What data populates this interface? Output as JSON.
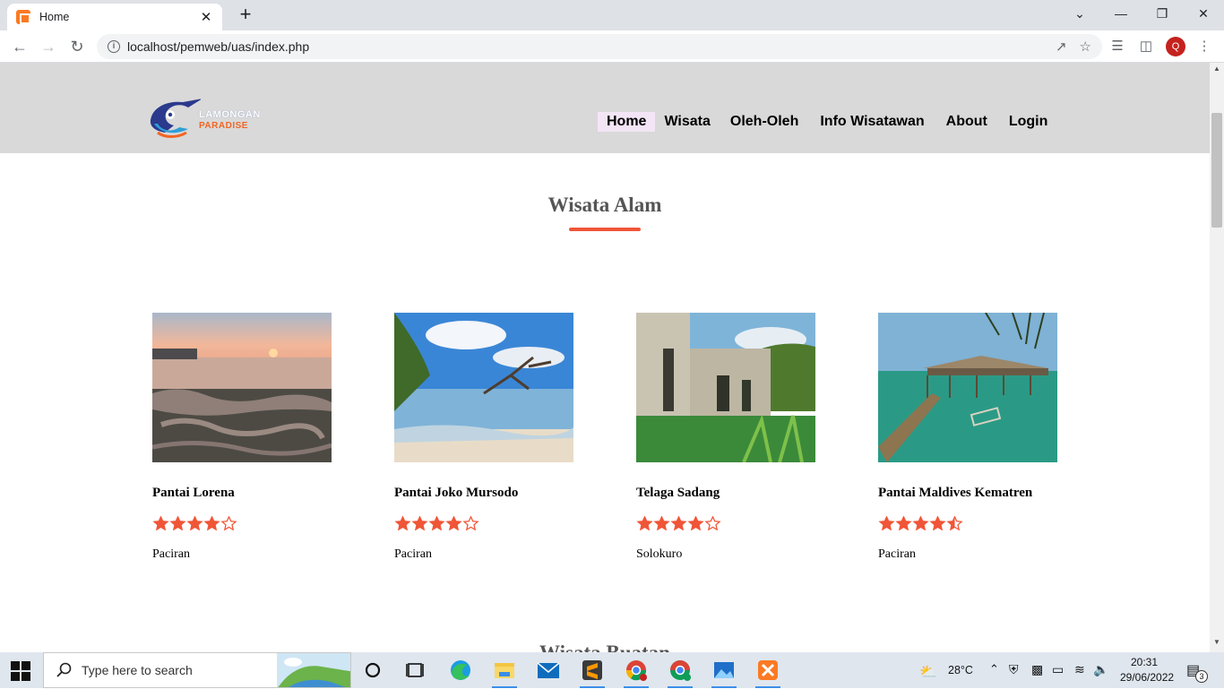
{
  "browser": {
    "tab_title": "Home",
    "tab_close": "✕",
    "new_tab": "+",
    "url": "localhost/pemweb/uas/index.php",
    "profile_initial": "Q"
  },
  "site": {
    "logo_line1": "LAMONGAN",
    "logo_line2": "PARADISE",
    "nav": [
      "Home",
      "Wisata",
      "Oleh-Oleh",
      "Info Wisatawan",
      "About",
      "Login"
    ],
    "active_nav": "Home",
    "section_title": "Wisata Alam",
    "next_section_title": "Wisata Buatan",
    "accent_color": "#f05537"
  },
  "cards": [
    {
      "name": "Pantai Lorena",
      "location": "Paciran",
      "rating": 4
    },
    {
      "name": "Pantai Joko Mursodo",
      "location": "Paciran",
      "rating": 4
    },
    {
      "name": "Telaga Sadang",
      "location": "Solokuro",
      "rating": 4
    },
    {
      "name": "Pantai Maldives Kematren",
      "location": "Paciran",
      "rating": 4.5
    }
  ],
  "taskbar": {
    "search_placeholder": "Type here to search",
    "weather": "28°C",
    "time": "20:31",
    "date": "29/06/2022",
    "notification_count": "3"
  }
}
